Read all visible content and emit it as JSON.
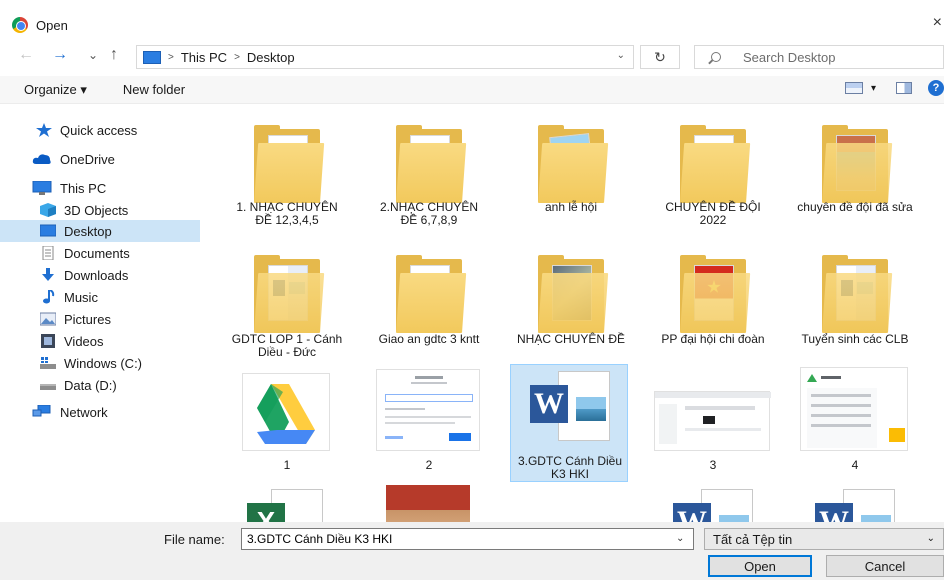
{
  "window": {
    "title": "Open",
    "close": "×"
  },
  "nav": {
    "back": "←",
    "forward": "→",
    "recent": "⌄",
    "up": "↑",
    "refresh": "↻",
    "breadcrumb": [
      "This PC",
      "Desktop"
    ],
    "search_placeholder": "Search Desktop"
  },
  "toolbar": {
    "organize": "Organize ▾",
    "new_folder": "New folder",
    "view_dd": "▾",
    "help": "?"
  },
  "sidebar": {
    "items": [
      {
        "label": "Quick access",
        "icon": "star-icon"
      },
      {
        "label": "OneDrive",
        "icon": "cloud-icon"
      },
      {
        "label": "This PC",
        "icon": "computer-icon"
      },
      {
        "label": "3D Objects",
        "icon": "cube-icon"
      },
      {
        "label": "Desktop",
        "icon": "desktop-icon"
      },
      {
        "label": "Documents",
        "icon": "document-icon"
      },
      {
        "label": "Downloads",
        "icon": "download-arrow-icon"
      },
      {
        "label": "Music",
        "icon": "music-note-icon"
      },
      {
        "label": "Pictures",
        "icon": "pictures-icon"
      },
      {
        "label": "Videos",
        "icon": "film-icon"
      },
      {
        "label": "Windows (C:)",
        "icon": "system-drive-icon"
      },
      {
        "label": "Data (D:)",
        "icon": "drive-icon"
      },
      {
        "label": "Network",
        "icon": "network-icon"
      }
    ]
  },
  "files": [
    {
      "name": "1. NHẠC CHUYÊN ĐỀ 12,3,4,5",
      "kind": "folder"
    },
    {
      "name": "2.NHẠC CHUYÊN ĐỀ 6,7,8,9",
      "kind": "folder"
    },
    {
      "name": "anh lễ hội",
      "kind": "folder-photo"
    },
    {
      "name": "CHUYÊN ĐỀ ĐỘI 2022",
      "kind": "folder"
    },
    {
      "name": "chuyên đề đội đã sửa",
      "kind": "folder-photo"
    },
    {
      "name": "GDTC LOP 1 - Cánh Diều - Đức",
      "kind": "folder-docs"
    },
    {
      "name": "Giao an gdtc 3 kntt",
      "kind": "folder"
    },
    {
      "name": "NHẠC CHUYÊN ĐỀ",
      "kind": "folder-photo"
    },
    {
      "name": "PP đại hội chi đoàn",
      "kind": "folder-photo"
    },
    {
      "name": "Tuyển sinh các CLB",
      "kind": "folder-docs"
    },
    {
      "name": "1",
      "kind": "drive-logo"
    },
    {
      "name": "2",
      "kind": "screenshot-form"
    },
    {
      "name": "3.GDTC Cánh Diều K3 HKI",
      "kind": "word-doc"
    },
    {
      "name": "3",
      "kind": "screenshot"
    },
    {
      "name": "4",
      "kind": "screenshot-drive"
    },
    {
      "name": "",
      "kind": "excel-doc"
    },
    {
      "name": "",
      "kind": "photo"
    },
    {
      "name": "",
      "kind": "word-doc"
    },
    {
      "name": "",
      "kind": "word-doc"
    }
  ],
  "footer": {
    "filename_label": "File name:",
    "filename_value": "3.GDTC Cánh Diều K3 HKI",
    "filetype": "Tất cả Tệp tin",
    "open": "Open",
    "cancel": "Cancel",
    "dd": "⌄"
  },
  "colors": {
    "selection": "#cce4f7",
    "accent": "#0078d7",
    "folder": "#f2c95c"
  }
}
